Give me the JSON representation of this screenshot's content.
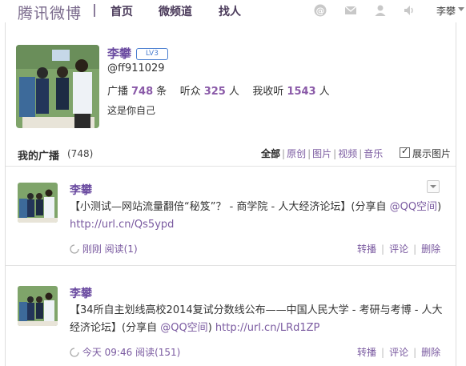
{
  "topbar": {
    "brand": "腾讯微博",
    "nav": [
      "首页",
      "微频道",
      "找人"
    ],
    "icons": [
      "at-icon",
      "mail-icon",
      "user-icon",
      "speaker-icon"
    ],
    "username": "李攀"
  },
  "profile": {
    "name": "李攀",
    "level_badge": "LV3",
    "handle": "@ff911029",
    "broadcast_label": "广播",
    "broadcast_count": "748",
    "broadcast_unit": "条",
    "listeners_label": "听众",
    "listeners_count": "325",
    "listeners_unit": "人",
    "following_label": "我收听",
    "following_count": "1543",
    "following_unit": "人",
    "bio": "这是你自己"
  },
  "section": {
    "title": "我的广播",
    "count": "(748)",
    "filters": [
      "全部",
      "原创",
      "图片",
      "视频",
      "音乐"
    ],
    "show_images_label": "展示图片"
  },
  "posts": [
    {
      "author": "李攀",
      "text": "【小测试—网站流量翻倍“秘笈”？ - 商学院 - 人大经济论坛】(分享自 ",
      "share_link": "@QQ空间",
      "after": ") ",
      "url": "http://url.cn/Qs5ypd",
      "time": "刚刚",
      "reads": "阅读(1)",
      "actions": [
        "转播",
        "评论",
        "删除"
      ]
    },
    {
      "author": "李攀",
      "text": "【34所自主划线高校2014复试分数线公布——中国人民大学 - 考研与考博 - 人大经济论坛】(分享自 ",
      "share_link": "@QQ空间",
      "after": ") ",
      "url": "http://url.cn/LRd1ZP",
      "time": "今天 09:46",
      "reads": "阅读(151)",
      "actions": [
        "转播",
        "评论",
        "删除"
      ]
    }
  ]
}
